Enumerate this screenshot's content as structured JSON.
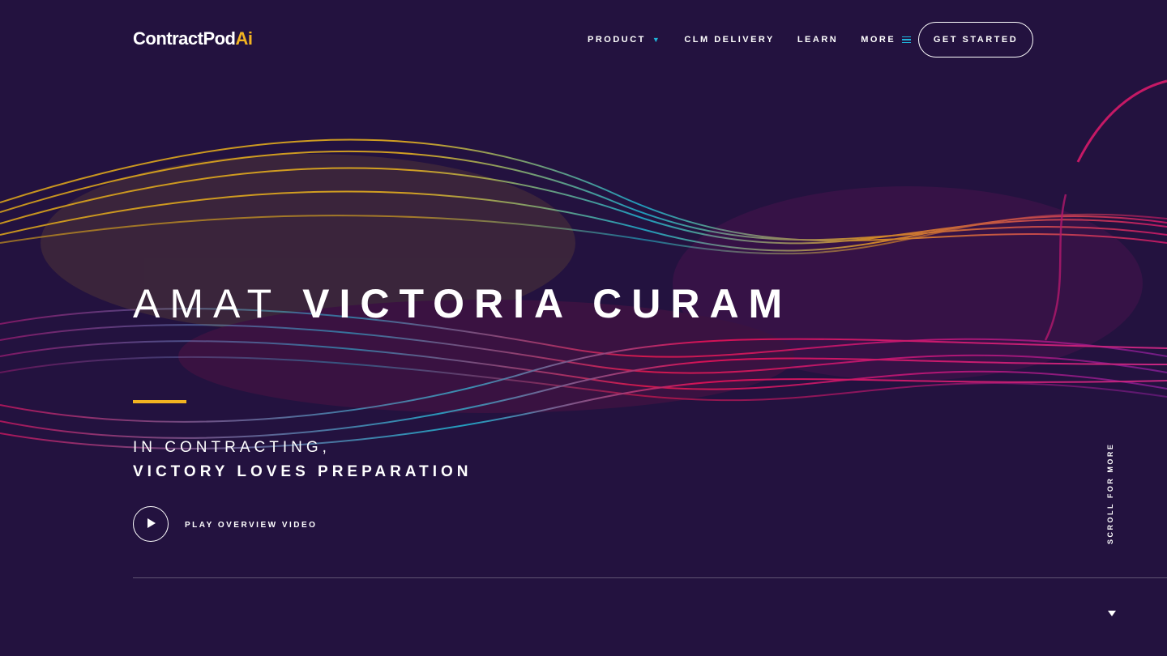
{
  "brand": {
    "name": "ContractPod",
    "suffix": "Ai"
  },
  "nav": {
    "items": [
      {
        "label": "PRODUCT",
        "icon": "caret-down-icon"
      },
      {
        "label": "CLM DELIVERY"
      },
      {
        "label": "LEARN"
      },
      {
        "label": "MORE",
        "icon": "menu-icon"
      }
    ],
    "cta_label": "GET STARTED"
  },
  "hero": {
    "headline_light": "AMAT",
    "headline_bold": "VICTORIA CURAM",
    "subline1": "IN CONTRACTING,",
    "subline2": "VICTORY LOVES PREPARATION",
    "play_label": "PLAY OVERVIEW VIDEO"
  },
  "scroll_label": "SCROLL FOR MORE",
  "colors": {
    "background": "#23123f",
    "accent_yellow": "#f2b321",
    "accent_blue": "#1fb2d9",
    "wave_magenta": "#e0196b"
  }
}
